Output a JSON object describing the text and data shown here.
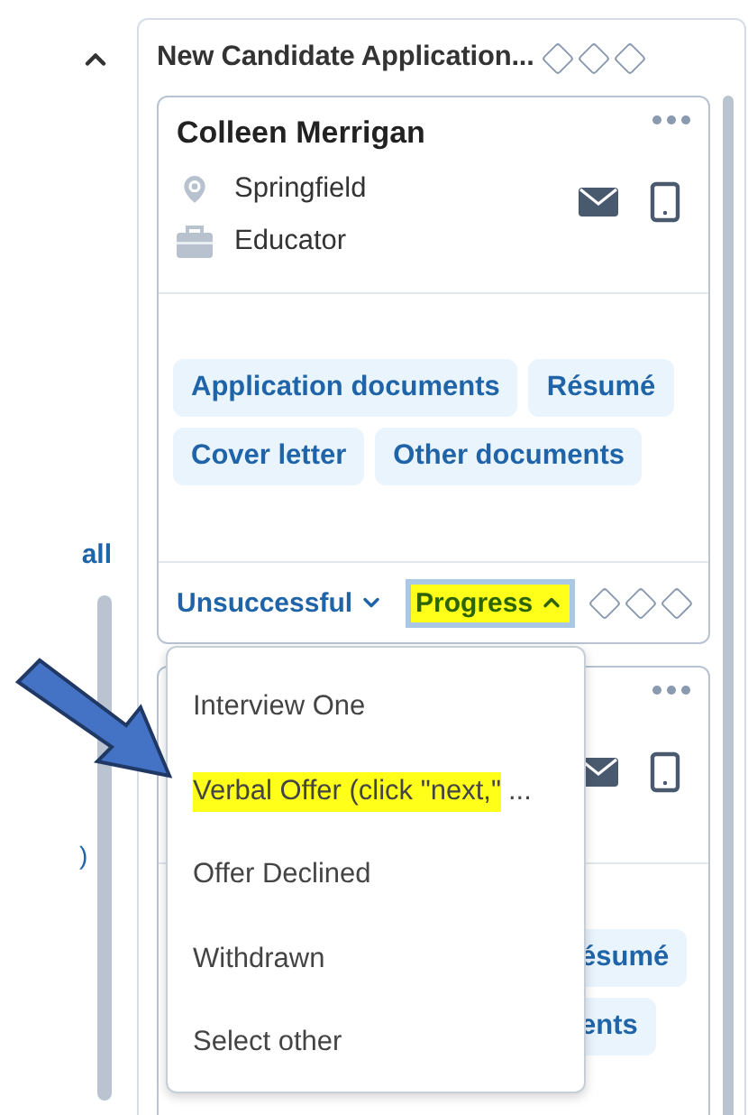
{
  "sidebar": {
    "link": "all",
    "fragment": ")"
  },
  "column": {
    "title": "New Candidate Application...",
    "stages": [
      {
        "filled": false
      },
      {
        "filled": false
      },
      {
        "filled": false
      }
    ]
  },
  "cards": [
    {
      "name": "Colleen Merrigan",
      "location": "Springfield",
      "occupation": "Educator",
      "documents": [
        "Application documents",
        "Résumé",
        "Cover letter",
        "Other documents"
      ],
      "actions": [
        {
          "label": "Unsuccessful",
          "expanded": false,
          "highlighted": false
        },
        {
          "label": "Progress",
          "expanded": true,
          "highlighted": true
        }
      ],
      "stages": [
        {
          "filled": false
        },
        {
          "filled": false
        },
        {
          "filled": false
        }
      ]
    },
    {
      "documents": [
        "ésumé",
        "ents"
      ]
    }
  ],
  "dropdown": {
    "items": [
      {
        "label": "Interview One",
        "highlighted": false
      },
      {
        "label": "Verbal Offer (click \"next,\"",
        "highlighted": true,
        "ellipsis": "..."
      },
      {
        "label": "Offer Declined",
        "highlighted": false
      },
      {
        "label": "Withdrawn",
        "highlighted": false
      },
      {
        "label": "Select other",
        "highlighted": false
      }
    ]
  }
}
